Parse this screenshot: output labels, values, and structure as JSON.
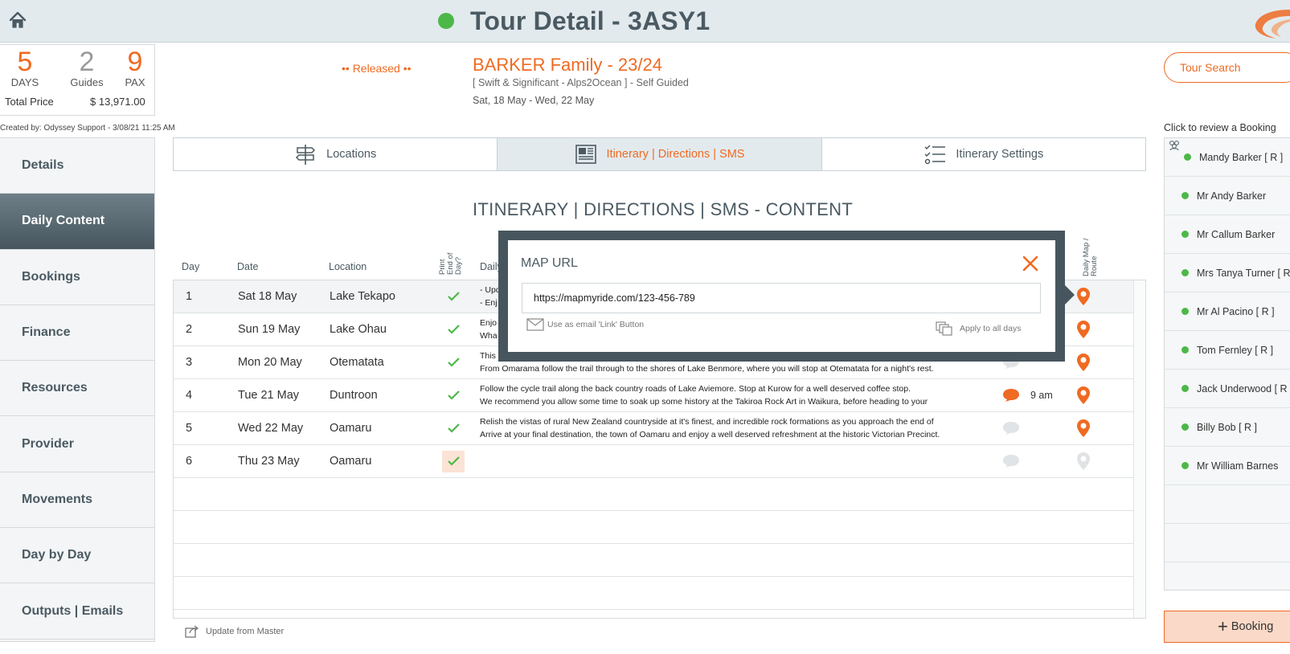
{
  "header": {
    "title": "Tour Detail - 3ASY1",
    "status_color": "#4cb848"
  },
  "summary": {
    "days_value": "5",
    "days_label": "DAYS",
    "guides_value": "2",
    "guides_label": "Guides",
    "pax_value": "9",
    "pax_label": "PAX",
    "total_label": "Total Price",
    "total_value": "$ 13,971.00",
    "created_by": "Created by: Odyssey Support - 3/08/21 11:25 AM"
  },
  "tour": {
    "status": "•• Released ••",
    "name": "BARKER Family - 23/24",
    "subtitle": "[ Swift & Significant - Alps2Ocean ] - Self Guided",
    "dates": "Sat, 18 May  - Wed, 22 May"
  },
  "tour_search_label": "Tour Search",
  "nav": {
    "items": [
      {
        "label": "Details",
        "active": false
      },
      {
        "label": "Daily Content",
        "active": true
      },
      {
        "label": "Bookings",
        "active": false
      },
      {
        "label": "Finance",
        "active": false
      },
      {
        "label": "Resources",
        "active": false
      },
      {
        "label": "Provider",
        "active": false
      },
      {
        "label": "Movements",
        "active": false
      },
      {
        "label": "Day by Day",
        "active": false
      },
      {
        "label": "Outputs | Emails",
        "active": false
      }
    ]
  },
  "tabs": [
    {
      "label": "Locations",
      "icon": "signpost-icon"
    },
    {
      "label": "Itinerary | Directions | SMS",
      "icon": "newspaper-icon",
      "active": true
    },
    {
      "label": "Itinerary Settings",
      "icon": "checklist-icon"
    }
  ],
  "section_title": "ITINERARY | DIRECTIONS | SMS - CONTENT",
  "table": {
    "headers": {
      "day": "Day",
      "date": "Date",
      "location": "Location",
      "print": "Print End of Day?",
      "content": "Daily",
      "map": "Daily Map / Route"
    },
    "rows": [
      {
        "day": "1",
        "date": "Sat 18 May",
        "location": "Lake Tekapo",
        "line1": "- Upd",
        "line2": "- Enj",
        "time": "",
        "bubble": "none",
        "pin": "orange",
        "check_highlight": false
      },
      {
        "day": "2",
        "date": "Sun 19 May",
        "location": "Lake Ohau",
        "line1": "Enjo",
        "line2": "Wha",
        "time": "",
        "bubble": "none",
        "pin": "orange",
        "check_highlight": false
      },
      {
        "day": "3",
        "date": "Mon 20 May",
        "location": "Otematata",
        "line1": "This",
        "line2": "From Omarama follow the trail through to the shores of Lake Benmore, where you will stop at Otematata for a night's rest.",
        "time": "",
        "bubble": "grey",
        "pin": "orange",
        "check_highlight": false
      },
      {
        "day": "4",
        "date": "Tue 21 May",
        "location": "Duntroon",
        "line1": "Follow the cycle trail along the back country roads of Lake Aviemore.  Stop at Kurow for a well deserved coffee stop.",
        "line2": "We recommend you allow some time to soak up some history at the Takiroa Rock Art in Waikura, before heading to your",
        "time": "9 am",
        "bubble": "orange",
        "pin": "orange",
        "check_highlight": false
      },
      {
        "day": "5",
        "date": "Wed 22 May",
        "location": "Oamaru",
        "line1": "Relish the vistas of rural New Zealand countryside at it's finest, and incredible rock formations as you approach the end of",
        "line2": "Arrive at your final destination, the town of Oamaru and enjoy a well deserved refreshment at the historic Victorian Precinct.",
        "time": "",
        "bubble": "grey",
        "pin": "orange",
        "check_highlight": false
      },
      {
        "day": "6",
        "date": "Thu 23 May",
        "location": "Oamaru",
        "line1": "",
        "line2": "",
        "time": "",
        "bubble": "grey",
        "pin": "grey",
        "check_highlight": true
      }
    ]
  },
  "update_master_label": "Update from Master",
  "bookings": {
    "review_label": "Click to review a Booking",
    "items": [
      "Mandy Barker  [ R ]",
      "Mr Andy Barker",
      "Mr Callum Barker",
      "Mrs Tanya Turner  [ R",
      "Mr Al Pacino  [ R ]",
      "Tom Fernley  [ R ]",
      "Jack Underwood  [ R",
      "Billy Bob  [ R ]",
      "Mr William Barnes"
    ],
    "add_label": "Booking"
  },
  "modal": {
    "title": "MAP URL",
    "url_value": "https://mapmyride.com/123-456-789",
    "email_option": "Use as email 'Link' Button",
    "apply_all": "Apply to all days"
  },
  "colors": {
    "accent": "#ef6a22",
    "status_green": "#4cb848",
    "slate": "#4b5a62"
  }
}
